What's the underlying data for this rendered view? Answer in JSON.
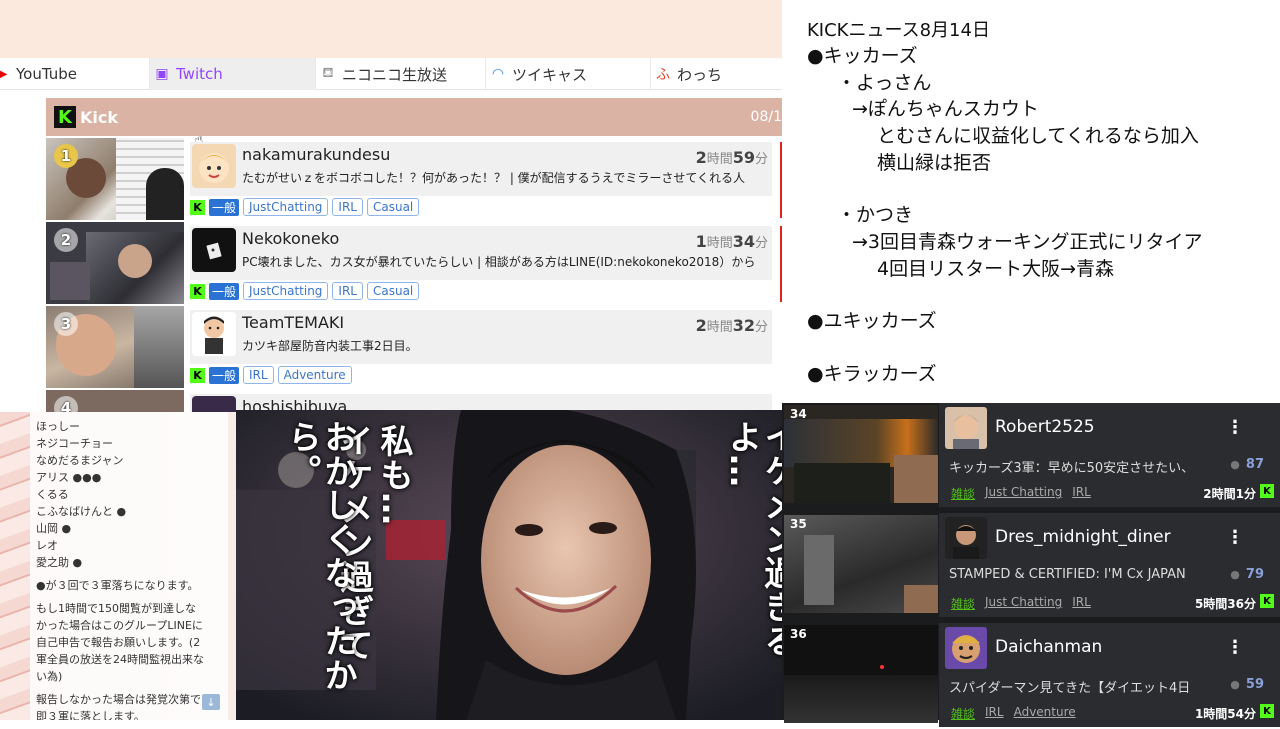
{
  "platform_tabs": [
    {
      "icon": "youtube-icon",
      "label": "YouTube"
    },
    {
      "icon": "twitch-icon",
      "label": "Twitch"
    },
    {
      "icon": "niconico-icon",
      "label": "ニコニコ生放送"
    },
    {
      "icon": "twitcasting-icon",
      "label": "ツイキャス"
    },
    {
      "icon": "whowatch-icon",
      "label": "わっち"
    }
  ],
  "kick": {
    "title": "Kick",
    "date": "08/1",
    "streams": [
      {
        "rank": "1",
        "name": "nakamurakundesu",
        "dur_h": "2",
        "dur_hu": "時間",
        "dur_m": "59",
        "dur_mu": "分",
        "desc": "たむがせいｚをボコボコした！？何があった！？ | 僕が配信するうえでミラーさせてくれる人",
        "cat": "一般",
        "tags": [
          "JustChatting",
          "IRL",
          "Casual"
        ]
      },
      {
        "rank": "2",
        "name": "Nekokoneko",
        "dur_h": "1",
        "dur_hu": "時間",
        "dur_m": "34",
        "dur_mu": "分",
        "desc": "PC壊れました、カス女が暴れていたらしい | 相談がある方はLINE(ID:nekokoneko2018）から",
        "cat": "一般",
        "tags": [
          "JustChatting",
          "IRL",
          "Casual"
        ]
      },
      {
        "rank": "3",
        "name": "TeamTEMAKI",
        "dur_h": "2",
        "dur_hu": "時間",
        "dur_m": "32",
        "dur_mu": "分",
        "desc": "カツキ部屋防音内装工事2日目。",
        "cat": "一般",
        "tags": [
          "IRL",
          "Adventure"
        ]
      },
      {
        "rank": "4",
        "name": "hoshishibuya",
        "dur_h": "",
        "dur_hu": "",
        "dur_m": "",
        "dur_mu": "",
        "desc": "",
        "cat": "",
        "tags": []
      }
    ]
  },
  "notes": {
    "lines": [
      "KICKニュース8月14日",
      "●キッカーズ",
      "・よっさん",
      "→ぽんちゃんスカウト",
      "とむさんに収益化してくれるなら加入",
      "横山緑は拒否",
      "・かつき",
      "→3回目青森ウォーキング正式にリタイア",
      "4回目リスタート大阪→青森",
      "●ユキッカーズ",
      "●キラッカーズ"
    ]
  },
  "chat": {
    "lines": [
      "ほっしー",
      "ネジコーチョー",
      "なめだるまジャン",
      "アリス ●●●",
      "くるる",
      "こふなばけんと ●",
      "山岡 ●",
      "レオ",
      "愛之助 ●",
      "",
      "●が３回で３軍落ちになります。",
      "",
      "もし1時間で150閲覧が到達しな",
      "かった場合はこのグループLINEに",
      "自己申告で報告お願いします。(2",
      "軍全員の放送を24時間監視出来な",
      "い為)",
      "",
      "報告しなかった場合は発覚次第で",
      "即３軍に落とします。"
    ]
  },
  "video": {
    "captions": [
      "イケメン過ぎるよ…",
      "私も…",
      "イケメン過ぎて",
      "おかしくなったから。"
    ]
  },
  "right_list": [
    {
      "rank": "34",
      "name": "Robert2525",
      "desc": "キッカーズ3軍：早めに50安定させたい、",
      "viewers": "87",
      "category": "雑談",
      "tags": [
        "Just Chatting",
        "IRL"
      ],
      "duration": "2時間1分"
    },
    {
      "rank": "35",
      "name": "Dres_midnight_diner",
      "desc": "STAMPED & CERTIFIED: I'M Cx JAPAN",
      "viewers": "79",
      "category": "雑談",
      "tags": [
        "Just Chatting",
        "IRL"
      ],
      "duration": "5時間36分"
    },
    {
      "rank": "36",
      "name": "Daichanman",
      "desc": "スパイダーマン見てきた【ダイエット4日",
      "viewers": "59",
      "category": "雑談",
      "tags": [
        "IRL",
        "Adventure"
      ],
      "duration": "1時間54分"
    }
  ],
  "colors": {
    "kick_green": "#53fc18",
    "kick_header": "#dbb3a5",
    "top_bar": "#fbe9de",
    "dark_panel": "#1b1c1e"
  }
}
